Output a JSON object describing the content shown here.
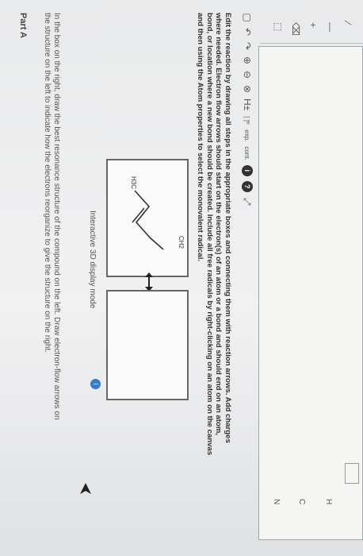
{
  "part": {
    "title": "Part A"
  },
  "prompt": {
    "text": "In the box on the right, draw the best resonance structure of the compound on the left. Draw electron-flow arrows on the structure on the left to indicate how the electrons reorganize to give the structure on the right."
  },
  "mode": {
    "label": "Interactive 3D display mode",
    "info_glyph": "i"
  },
  "molecule": {
    "left_label": "H3C",
    "right_label": "CH2",
    "radical_symbol": "•"
  },
  "instructions": {
    "text": "Edit the reaction by drawing all steps in the appropriate boxes and connecting them with reaction arrows. Add charges where needed. Electron flow arrows should start on the electron(s) of an atom or a bond and should end on an atom, bond, or location where a new bond should be created. Include all free radicals by right-clicking on an atom on the canvas and then using the Atom properties to select the monovalent radical."
  },
  "toolbar": {
    "tools": [
      {
        "name": "new-document-icon",
        "glyph": "▢"
      },
      {
        "name": "undo-icon",
        "glyph": "↶"
      },
      {
        "name": "redo-icon",
        "glyph": "↷"
      },
      {
        "name": "zoom-in-icon",
        "glyph": "⊕"
      },
      {
        "name": "zoom-out-icon",
        "glyph": "⊖"
      },
      {
        "name": "clear-icon",
        "glyph": "⊗"
      },
      {
        "name": "hydrogen-toggle-icon",
        "glyph": "H±"
      },
      {
        "name": "explicit-hydrogen-icon",
        "glyph": "[ ]ᴴ"
      },
      {
        "name": "expand-icon",
        "glyph": "exp."
      },
      {
        "name": "contract-icon",
        "glyph": "cont."
      },
      {
        "name": "info-icon",
        "glyph": "i"
      },
      {
        "name": "help-icon",
        "glyph": "?"
      },
      {
        "name": "fullscreen-icon",
        "glyph": "⤢"
      }
    ]
  },
  "sidebar": {
    "tools": [
      {
        "name": "select-tool-icon",
        "glyph": "⬚"
      },
      {
        "name": "eraser-tool-icon",
        "glyph": "⌫"
      },
      {
        "name": "charge-plus-icon",
        "glyph": "+"
      },
      {
        "name": "single-bond-icon",
        "glyph": "—"
      },
      {
        "name": "chain-tool-icon",
        "glyph": "∕"
      }
    ]
  },
  "elements": [
    "H",
    "C",
    "N"
  ],
  "colors": {
    "accent": "#3a7bc8",
    "box_border": "#666666"
  }
}
